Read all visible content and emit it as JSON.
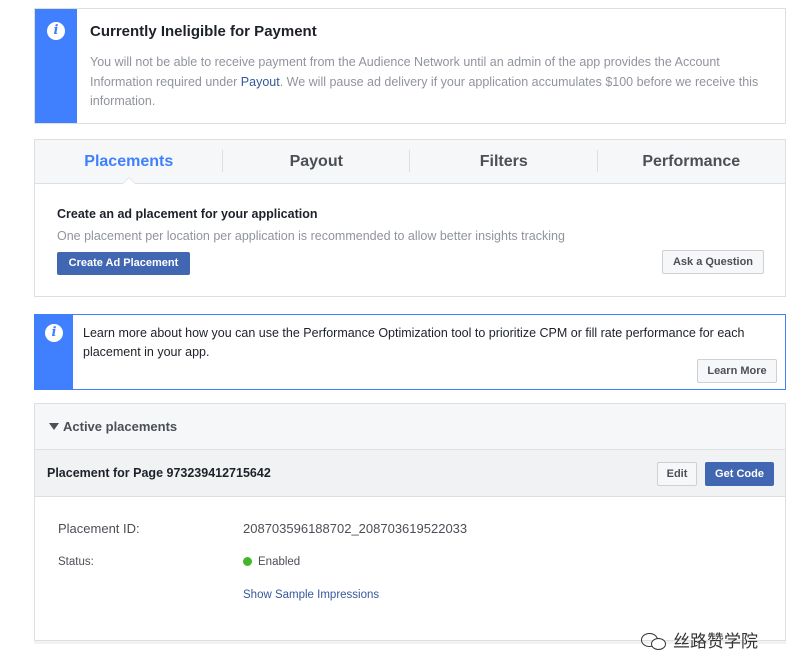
{
  "ineligible_banner": {
    "icon": "info-icon",
    "title": "Currently Ineligible for Payment",
    "body_part1": "You will not be able to receive payment from the Audience Network until an admin of the app provides the Account Information required under ",
    "body_link": "Payout",
    "body_part2": ". We will pause ad delivery if your application accumulates $100 before we receive this information."
  },
  "tabs": [
    {
      "label": "Placements",
      "active": true
    },
    {
      "label": "Payout",
      "active": false
    },
    {
      "label": "Filters",
      "active": false
    },
    {
      "label": "Performance",
      "active": false
    }
  ],
  "placements_panel": {
    "heading": "Create an ad placement for your application",
    "subtext": "One placement per location per application is recommended to allow better insights tracking",
    "create_button": "Create Ad Placement",
    "ask_button": "Ask a Question"
  },
  "optimization_banner": {
    "icon": "info-icon",
    "text": "Learn more about how you can use the Performance Optimization tool to prioritize CPM or fill rate performance for each placement in your app.",
    "learn_more_button": "Learn More"
  },
  "active_placements": {
    "header": "Active placements",
    "placement_name": "Placement for Page 973239412715642",
    "edit_button": "Edit",
    "get_code_button": "Get Code",
    "placement_id_label": "Placement ID:",
    "placement_id_value": "208703596188702_208703619522033",
    "status_label": "Status:",
    "status_value": "Enabled",
    "sample_link": "Show Sample Impressions"
  },
  "watermark": {
    "icon": "wechat-icon",
    "text": "丝路赞学院"
  },
  "colors": {
    "accent_blue": "#4080ff",
    "button_blue": "#4267b2",
    "link_blue": "#365899",
    "status_green": "#42b72a"
  }
}
